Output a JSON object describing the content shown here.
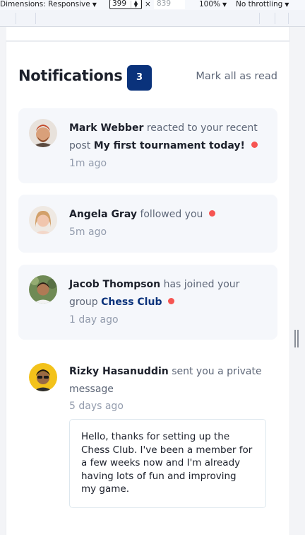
{
  "devtools": {
    "dimensions_label": "Dimensions: Responsive",
    "width_value": "399",
    "times": "×",
    "height_value": "839",
    "zoom": "100%",
    "throttling": "No throttling"
  },
  "header": {
    "title": "Notifications",
    "unread_count": "3",
    "mark_all_label": "Mark all as read"
  },
  "notifications": [
    {
      "name": "Mark Webber",
      "action": "reacted to your recent post",
      "target": "My first tournament today!",
      "time": "1m ago",
      "unread": true
    },
    {
      "name": "Angela Gray",
      "action": "followed you",
      "time": "5m ago",
      "unread": true
    },
    {
      "name": "Jacob Thompson",
      "action": "has joined your group",
      "target": "Chess Club",
      "time": "1 day ago",
      "unread": true
    },
    {
      "name": "Rizky Hasanuddin",
      "action": "sent you a private message",
      "time": "5 days ago",
      "unread": false,
      "message": "Hello, thanks for setting up the Chess Club. I've been a member for a few weeks now and I'm already having lots of fun and improving my game."
    }
  ],
  "colors": {
    "badge": "#0a327b",
    "unread_dot": "#f65552",
    "unread_bg": "#f5f7fb",
    "group_link": "#0a327b"
  }
}
